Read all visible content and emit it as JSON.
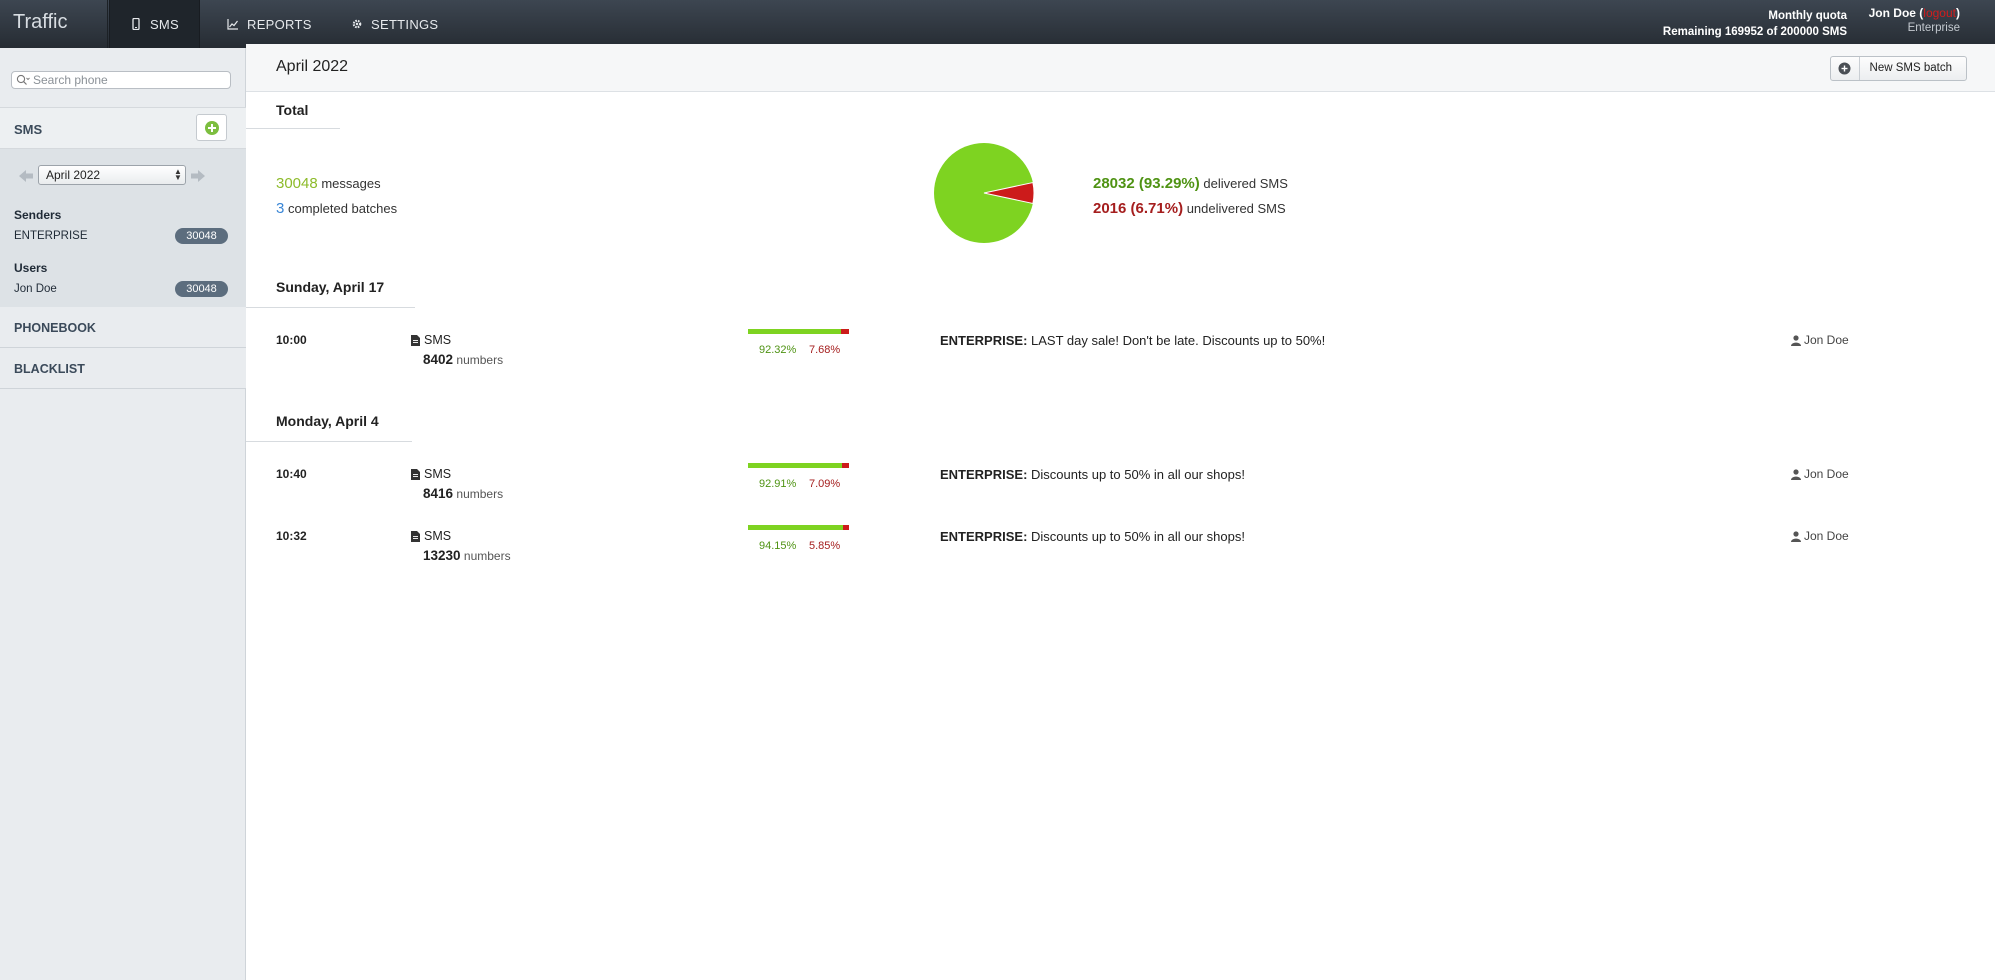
{
  "topbar": {
    "brand": "Traffic",
    "tabs": [
      {
        "label": "SMS",
        "icon": "mobile-phone-icon",
        "active": true
      },
      {
        "label": "REPORTS",
        "icon": "line-chart-icon",
        "active": false
      },
      {
        "label": "SETTINGS",
        "icon": "gear-icon",
        "active": false
      }
    ],
    "quota_title": "Monthly quota",
    "quota_text": "Remaining 169952 of 200000 SMS",
    "user_name": "Jon Doe",
    "open_paren": "(",
    "logout_label": "logout",
    "close_paren": ")",
    "org": "Enterprise"
  },
  "sidebar": {
    "search_placeholder": "Search phone",
    "sms_label": "SMS",
    "month_selected": "April 2022",
    "senders_title": "Senders",
    "senders": [
      {
        "name": "ENTERPRISE",
        "count": "30048"
      }
    ],
    "users_title": "Users",
    "users": [
      {
        "name": "Jon Doe",
        "count": "30048"
      }
    ],
    "nav": [
      "PHONEBOOK",
      "BLACKLIST"
    ]
  },
  "main": {
    "title": "April 2022",
    "new_batch_label": "New SMS batch",
    "total_heading": "Total",
    "messages_count": "30048",
    "messages_label": "messages",
    "batches_count": "3",
    "batches_label": "completed batches",
    "delivered_value": "28032 (93.29%)",
    "delivered_label": "delivered SMS",
    "undelivered_value": "2016 (6.71%)",
    "undelivered_label": "undelivered SMS",
    "delivered_fraction": 0.9329,
    "colors": {
      "delivered": "#7ed321",
      "undelivered": "#cc1b1b"
    },
    "days": [
      {
        "heading": "Sunday, April 17",
        "batches": [
          {
            "time": "10:00",
            "type": "SMS",
            "numbers": "8402",
            "numbers_label": "numbers",
            "delivered_pct": "92.32%",
            "undelivered_pct": "7.68%",
            "delivered_fraction": 0.9232,
            "sender": "ENTERPRISE:",
            "text": "LAST day sale! Don't be late. Discounts up to 50%!",
            "user": "Jon Doe"
          }
        ]
      },
      {
        "heading": "Monday, April 4",
        "batches": [
          {
            "time": "10:40",
            "type": "SMS",
            "numbers": "8416",
            "numbers_label": "numbers",
            "delivered_pct": "92.91%",
            "undelivered_pct": "7.09%",
            "delivered_fraction": 0.9291,
            "sender": "ENTERPRISE:",
            "text": "Discounts up to 50% in all our shops!",
            "user": "Jon Doe"
          },
          {
            "time": "10:32",
            "type": "SMS",
            "numbers": "13230",
            "numbers_label": "numbers",
            "delivered_pct": "94.15%",
            "undelivered_pct": "5.85%",
            "delivered_fraction": 0.9415,
            "sender": "ENTERPRISE:",
            "text": "Discounts up to 50% in all our shops!",
            "user": "Jon Doe"
          }
        ]
      }
    ]
  }
}
